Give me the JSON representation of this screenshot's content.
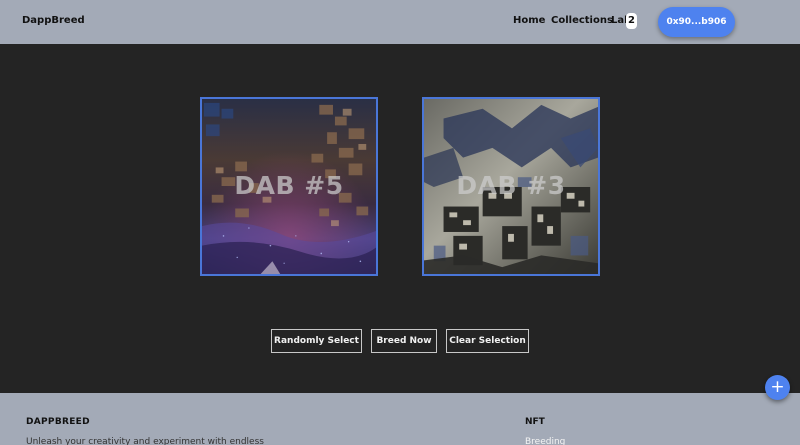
{
  "navbar": {
    "brand": "DappBreed",
    "links": [
      {
        "label": "Home"
      },
      {
        "label": "Collections"
      },
      {
        "label": "Lab"
      }
    ],
    "lab_count": "2",
    "wallet_label": "0x90...b906",
    "accent_color": "#4e82ef"
  },
  "cards": [
    {
      "title": "DAB #5"
    },
    {
      "title": "DAB #3"
    }
  ],
  "actions": {
    "random_label": "Randomly Select",
    "breed_label": "Breed Now",
    "clear_label": "Clear Selection"
  },
  "footer": {
    "brand": "DAPPBREED",
    "tagline": "Unleash your creativity and experiment with endless",
    "nft_heading": "NFT",
    "breeding_link": "Breeding"
  },
  "fab": {
    "icon": "plus-icon",
    "symbol": "+"
  }
}
